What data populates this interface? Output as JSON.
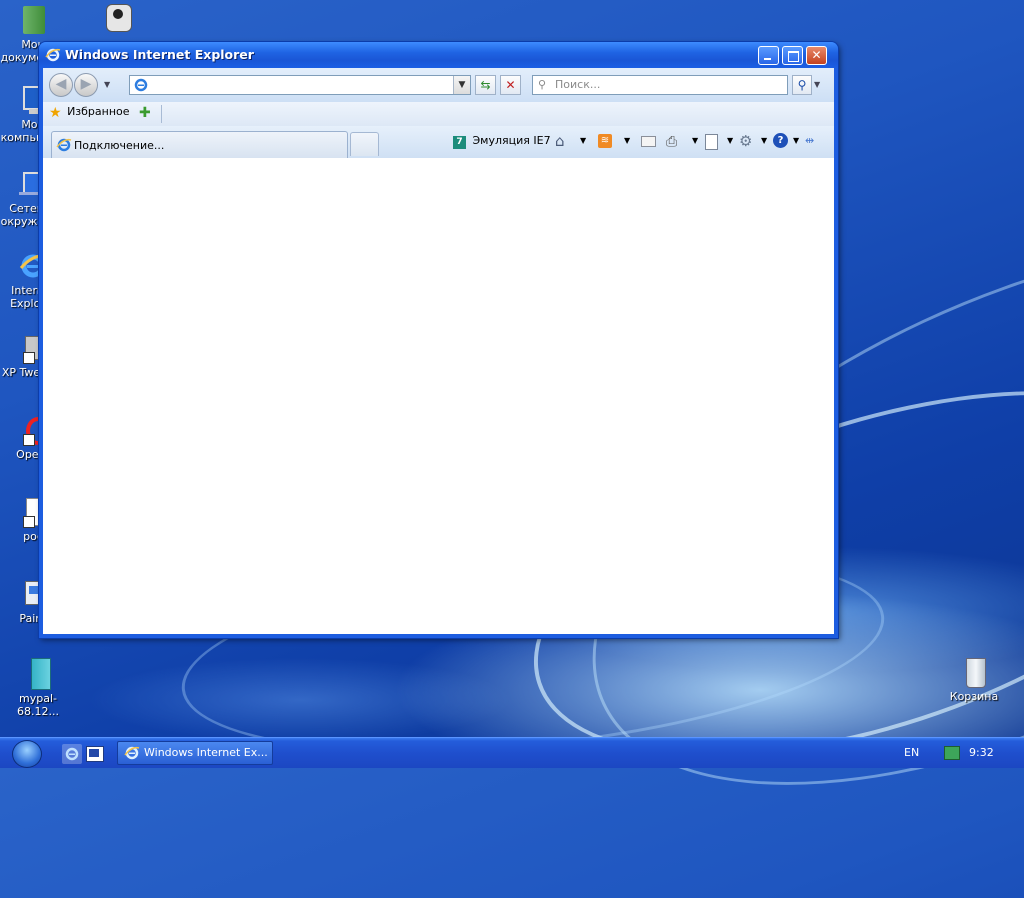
{
  "desktop": {
    "icons": [
      {
        "id": "my-documents",
        "label": "Мои\nдокументы"
      },
      {
        "id": "my-computer",
        "label": "Мой\nкомпьютер"
      },
      {
        "id": "network",
        "label": "Сетевое\nокружение"
      },
      {
        "id": "internet-explorer",
        "label": "Internet\nExplorer"
      },
      {
        "id": "xp-tweaker",
        "label": "XP Tweaker"
      },
      {
        "id": "opera",
        "label": "Opera"
      },
      {
        "id": "poc",
        "label": "poc"
      },
      {
        "id": "paint",
        "label": "Paint"
      },
      {
        "id": "mypal",
        "label": "mypal-68.12..."
      },
      {
        "id": "recycle-bin",
        "label": "Корзина"
      }
    ]
  },
  "window": {
    "title": "Windows Internet Explorer",
    "address_value": "",
    "search_placeholder": "Поиск...",
    "favorites_label": "Избранное",
    "tab_label": "Подключение...",
    "emulation_label": "Эмуляция IE7"
  },
  "taskbar": {
    "task_label": "Windows Internet Ex...",
    "language": "EN",
    "clock": "9:32"
  },
  "colors": {
    "desktop_blue": "#1f56c0",
    "titlebar_blue": "#1f64e3",
    "close_red": "#c4421f"
  }
}
